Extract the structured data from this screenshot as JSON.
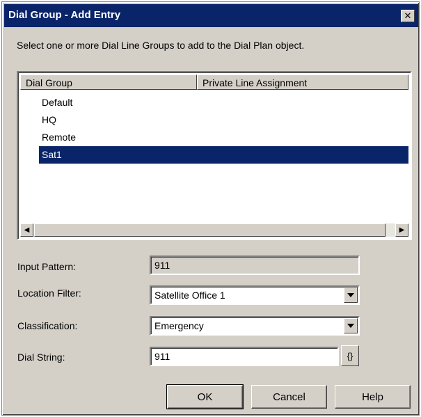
{
  "window": {
    "title": "Dial Group - Add Entry",
    "close_glyph": "✕"
  },
  "prompt": "Select one or more Dial Line Groups to add to the Dial Plan object.",
  "list": {
    "columns": [
      "Dial Group",
      "Private Line Assignment"
    ],
    "rows": [
      {
        "label": "Default",
        "selected": false
      },
      {
        "label": "HQ",
        "selected": false
      },
      {
        "label": "Remote",
        "selected": false
      },
      {
        "label": "Sat1",
        "selected": true
      }
    ],
    "scroll_left_glyph": "◀",
    "scroll_right_glyph": "▶"
  },
  "form": {
    "input_pattern": {
      "label": "Input Pattern:",
      "value": "911"
    },
    "location_filter": {
      "label": "Location Filter:",
      "value": "Satellite Office 1"
    },
    "classification": {
      "label": "Classification:",
      "value": "Emergency"
    },
    "dial_string": {
      "label": "Dial String:",
      "value": "911",
      "braces_label": "{}"
    }
  },
  "buttons": {
    "ok": "OK",
    "cancel": "Cancel",
    "help": "Help"
  },
  "colors": {
    "selection": "#0a246a",
    "face": "#d4d0c8"
  }
}
